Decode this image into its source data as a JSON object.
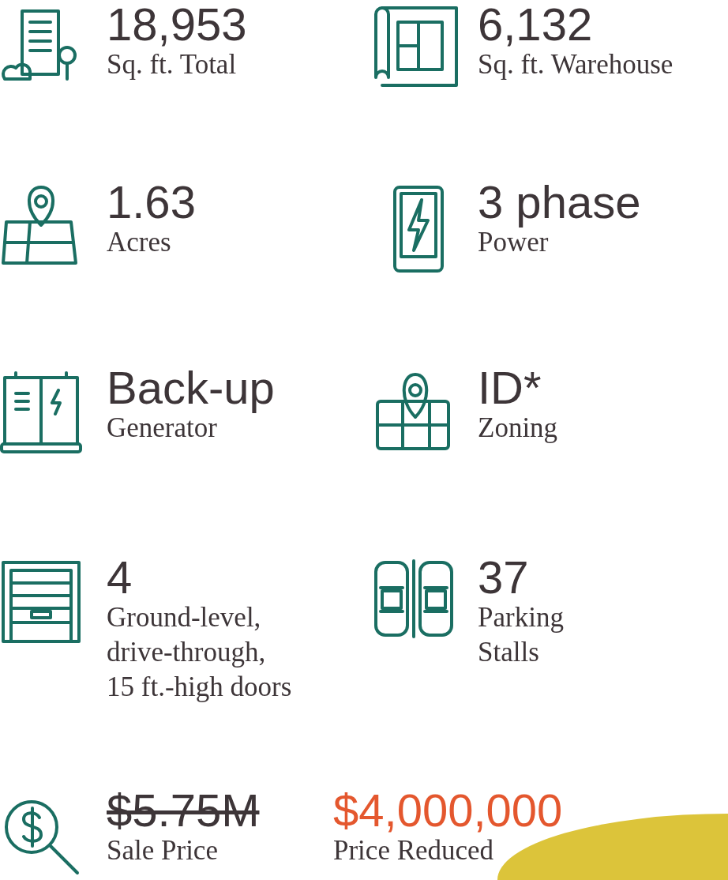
{
  "stats": [
    {
      "kind": "building",
      "value": "18,953",
      "label_lines": [
        "Sq. ft. Total"
      ]
    },
    {
      "kind": "blueprint",
      "value": "6,132",
      "label_lines": [
        "Sq. ft. Warehouse"
      ]
    },
    {
      "kind": "map-pin",
      "value": "1.63",
      "label_lines": [
        "Acres"
      ]
    },
    {
      "kind": "bolt",
      "value": "3 phase",
      "label_lines": [
        "Power"
      ]
    },
    {
      "kind": "generator",
      "value": "Back-up",
      "label_lines": [
        "Generator"
      ]
    },
    {
      "kind": "map",
      "value": "ID*",
      "label_lines": [
        "Zoning"
      ]
    },
    {
      "kind": "garage",
      "value": "4",
      "label_lines": [
        "Ground-level,",
        "drive-through,",
        "15 ft.-high doors"
      ]
    },
    {
      "kind": "cars",
      "value": "37",
      "label_lines": [
        "Parking",
        "Stalls"
      ]
    }
  ],
  "price": {
    "kind": "dollar-search",
    "old_value": "$5.75M",
    "old_struck": true,
    "old_label": "Sale Price",
    "new_value": "$4,000,000",
    "new_label": "Price Reduced"
  }
}
